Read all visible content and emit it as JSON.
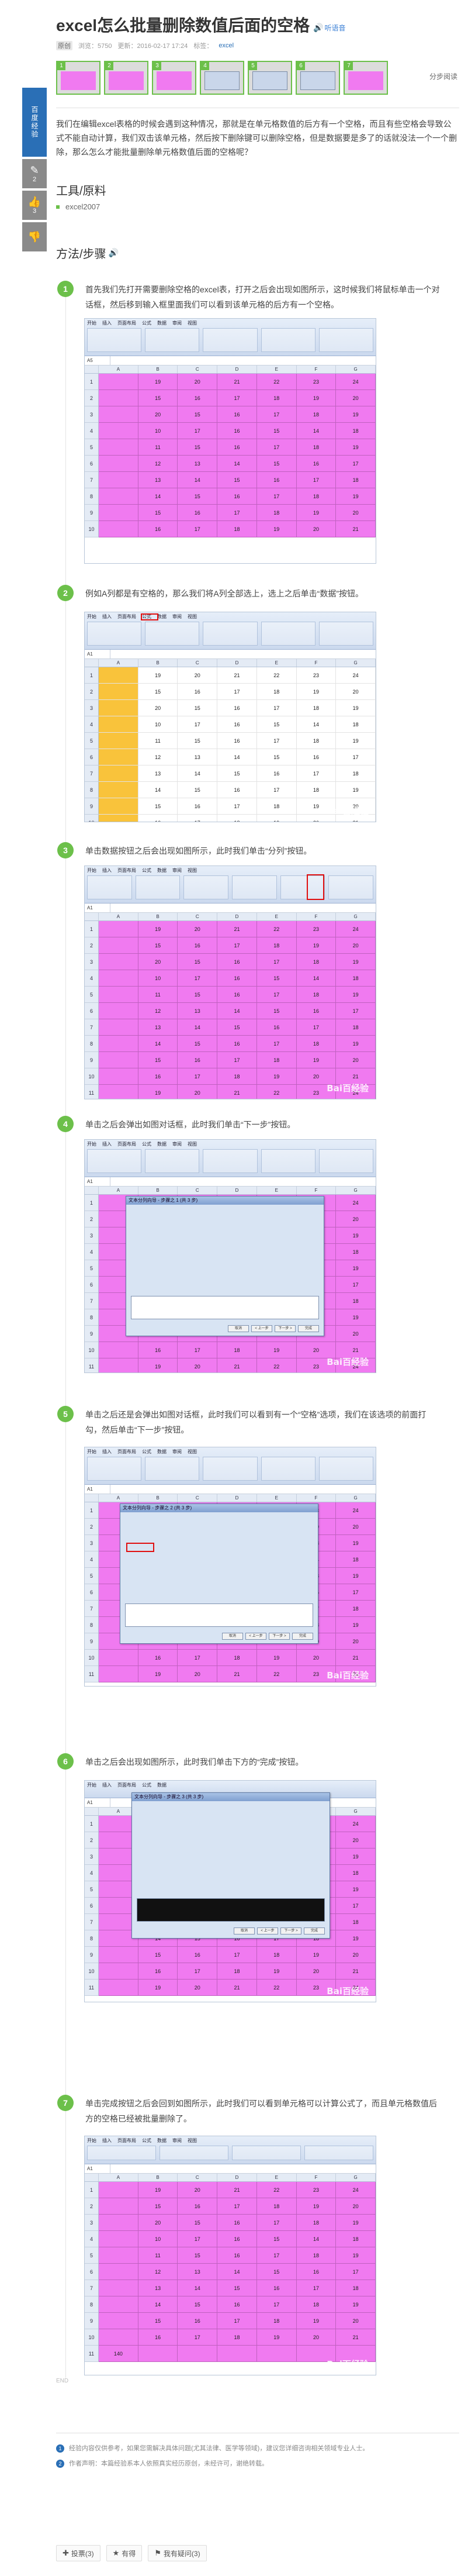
{
  "title": "excel怎么批量删除数值后面的空格",
  "speak_label": "听语音",
  "meta": {
    "rank": "原创",
    "views": "浏览：5750",
    "updated": "更新：2016-02-17 17:24",
    "tags_label": "标签：",
    "tag": "excel"
  },
  "share_label": "分步阅读",
  "float_bar": {
    "title": "百度经验",
    "items": [
      {
        "glyph": "✎",
        "label": "2"
      },
      {
        "glyph": "👍",
        "label": "3"
      },
      {
        "glyph": "👎",
        "label": ""
      }
    ]
  },
  "intro": "我们在编辑excel表格的时候会遇到这种情况，那就是在单元格数值的后方有一个空格，而且有些空格会导致公式不能自动计算，我们双击该单元格，然后按下删除键可以删除空格，但是数据要是多了的话就没法一个一个删除，那么怎么才能批量删除单元格数值后面的空格呢？",
  "tools": {
    "title": "工具/原料",
    "items": [
      "excel2007"
    ]
  },
  "method": {
    "title": "方法/步骤",
    "steps": [
      {
        "num": "1",
        "text": "首先我们先打开需要删除空格的excel表，打开之后会出现如图所示，这时候我们将鼠标单击一个对话框，然后移到输入框里面我们可以看到该单元格的后方有一个空格。"
      },
      {
        "num": "2",
        "text": "例如A列都是有空格的，那么我们将A列全部选上，选上之后单击“数据”按钮。"
      },
      {
        "num": "3",
        "text": "单击数据按钮之后会出现如图所示，此时我们单击“分列”按钮。"
      },
      {
        "num": "4",
        "text": "单击之后会弹出如图对话框，此时我们单击“下一步”按钮。"
      },
      {
        "num": "5",
        "text": "单击之后还是会弹出如图对话框，此时我们可以看到有一个“空格”选项，我们在该选项的前面打勾，然后单击“下一步”按钮。"
      },
      {
        "num": "6",
        "text": "单击之后会出现如图所示，此时我们单击下方的“完成”按钮。"
      },
      {
        "num": "7",
        "text": "单击完成按钮之后会回到如图所示，此时我们可以看到单元格可以计算公式了，而且单元格数值后方的空格已经被批量删除了。"
      }
    ]
  },
  "watermark": "Bai百经验",
  "dialog_title": "文本分列向导 - 步骤之 2 (共 3 步)",
  "dialog_title_1": "文本分列向导 - 步骤之 1 (共 3 步)",
  "dialog_title_3": "文本分列向导 - 步骤之 3 (共 3 步)",
  "dialog_buttons": {
    "cancel": "取消",
    "back": "< 上一步",
    "next": "下一步 >",
    "finish": "完成"
  },
  "columns": [
    "A",
    "B",
    "C",
    "D",
    "E",
    "F",
    "G"
  ],
  "sheet_values": [
    [
      "19",
      "20",
      "21",
      "22",
      "23",
      "24"
    ],
    [
      "15",
      "16",
      "17",
      "18",
      "19",
      "20"
    ],
    [
      "20",
      "15",
      "16",
      "17",
      "18",
      "19"
    ],
    [
      "10",
      "17",
      "16",
      "15",
      "14",
      "18"
    ],
    [
      "11",
      "15",
      "16",
      "17",
      "18",
      "19"
    ],
    [
      "12",
      "13",
      "14",
      "15",
      "16",
      "17"
    ],
    [
      "13",
      "14",
      "15",
      "16",
      "17",
      "18"
    ],
    [
      "14",
      "15",
      "16",
      "17",
      "18",
      "19"
    ],
    [
      "15",
      "16",
      "17",
      "18",
      "19",
      "20"
    ],
    [
      "16",
      "17",
      "18",
      "19",
      "20",
      "21"
    ]
  ],
  "total_row": [
    "140"
  ],
  "footer_note": "END",
  "notes": [
    {
      "n": "1",
      "text": "经验内容仅供参考，如果您需解决具体问题(尤其法律、医学等领域)，建议您详细咨询相关领域专业人士。"
    },
    {
      "n": "2",
      "text": "作者声明：本篇经验系本人依照真实经历原创，未经许可，谢绝转载。"
    }
  ],
  "actions": [
    {
      "glyph": "✚",
      "label": "投票(3)"
    },
    {
      "glyph": "★",
      "label": "有得"
    },
    {
      "glyph": "⚑",
      "label": "我有疑问(3)"
    }
  ]
}
